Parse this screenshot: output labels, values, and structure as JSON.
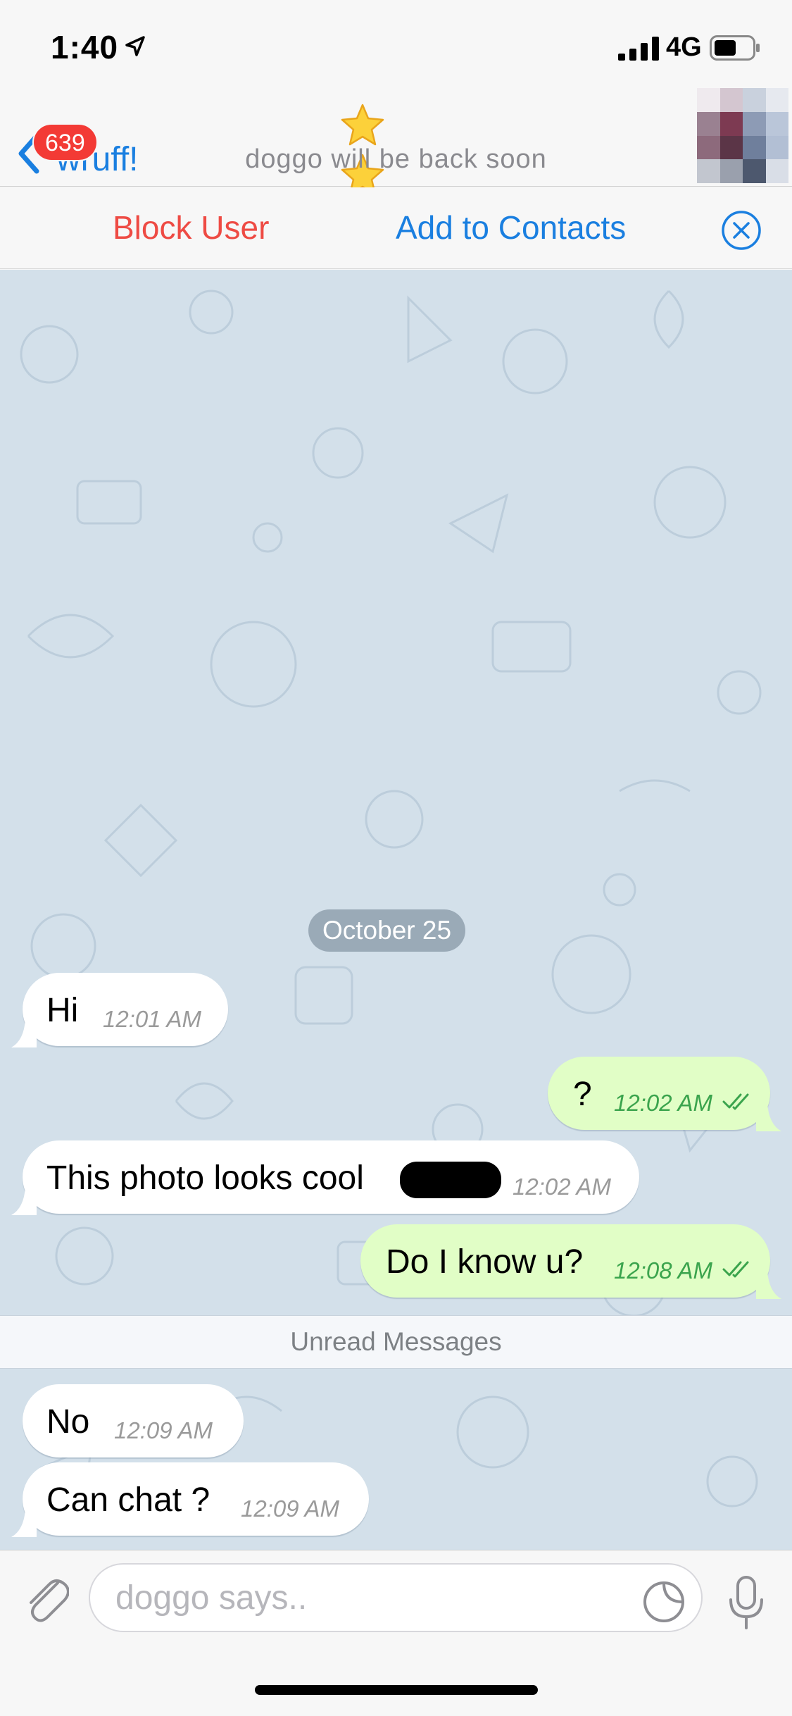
{
  "status_bar": {
    "time": "1:40",
    "network": "4G",
    "icons": [
      "location-arrow-icon",
      "signal-bars-icon",
      "battery-icon"
    ]
  },
  "header": {
    "back_label": "wruff!",
    "unread_badge": "639",
    "title_icons": [
      "star-icon",
      "star-icon"
    ],
    "subtitle": "doggo will be back soon",
    "avatar": "pixelated-avatar"
  },
  "action_bar": {
    "block_label": "Block User",
    "add_label": "Add to Contacts",
    "close_icon": "close-circle-icon"
  },
  "chat": {
    "date_label": "October 25",
    "unread_label": "Unread Messages",
    "messages": [
      {
        "direction": "in",
        "text": "Hi",
        "time": "12:01 AM"
      },
      {
        "direction": "out",
        "text": "?",
        "time": "12:02 AM",
        "read": true
      },
      {
        "direction": "in",
        "text": "This photo looks cool",
        "time": "12:02 AM",
        "redacted": true
      },
      {
        "direction": "out",
        "text": "Do I know u?",
        "time": "12:08 AM",
        "read": true
      },
      {
        "direction": "in",
        "text": "No",
        "time": "12:09 AM"
      },
      {
        "direction": "in",
        "text": "Can chat ?",
        "time": "12:09 AM"
      }
    ]
  },
  "input_bar": {
    "placeholder": "doggo says..",
    "icons": [
      "paperclip-icon",
      "sticker-icon",
      "microphone-icon"
    ]
  },
  "colors": {
    "accent_blue": "#1a7fe0",
    "destructive_red": "#ee4b44",
    "badge_red": "#f33a35",
    "outgoing_bubble": "#e1fec6",
    "incoming_bubble": "#ffffff",
    "chat_background": "#d3e0ea",
    "outgoing_time": "#3ba44d"
  }
}
